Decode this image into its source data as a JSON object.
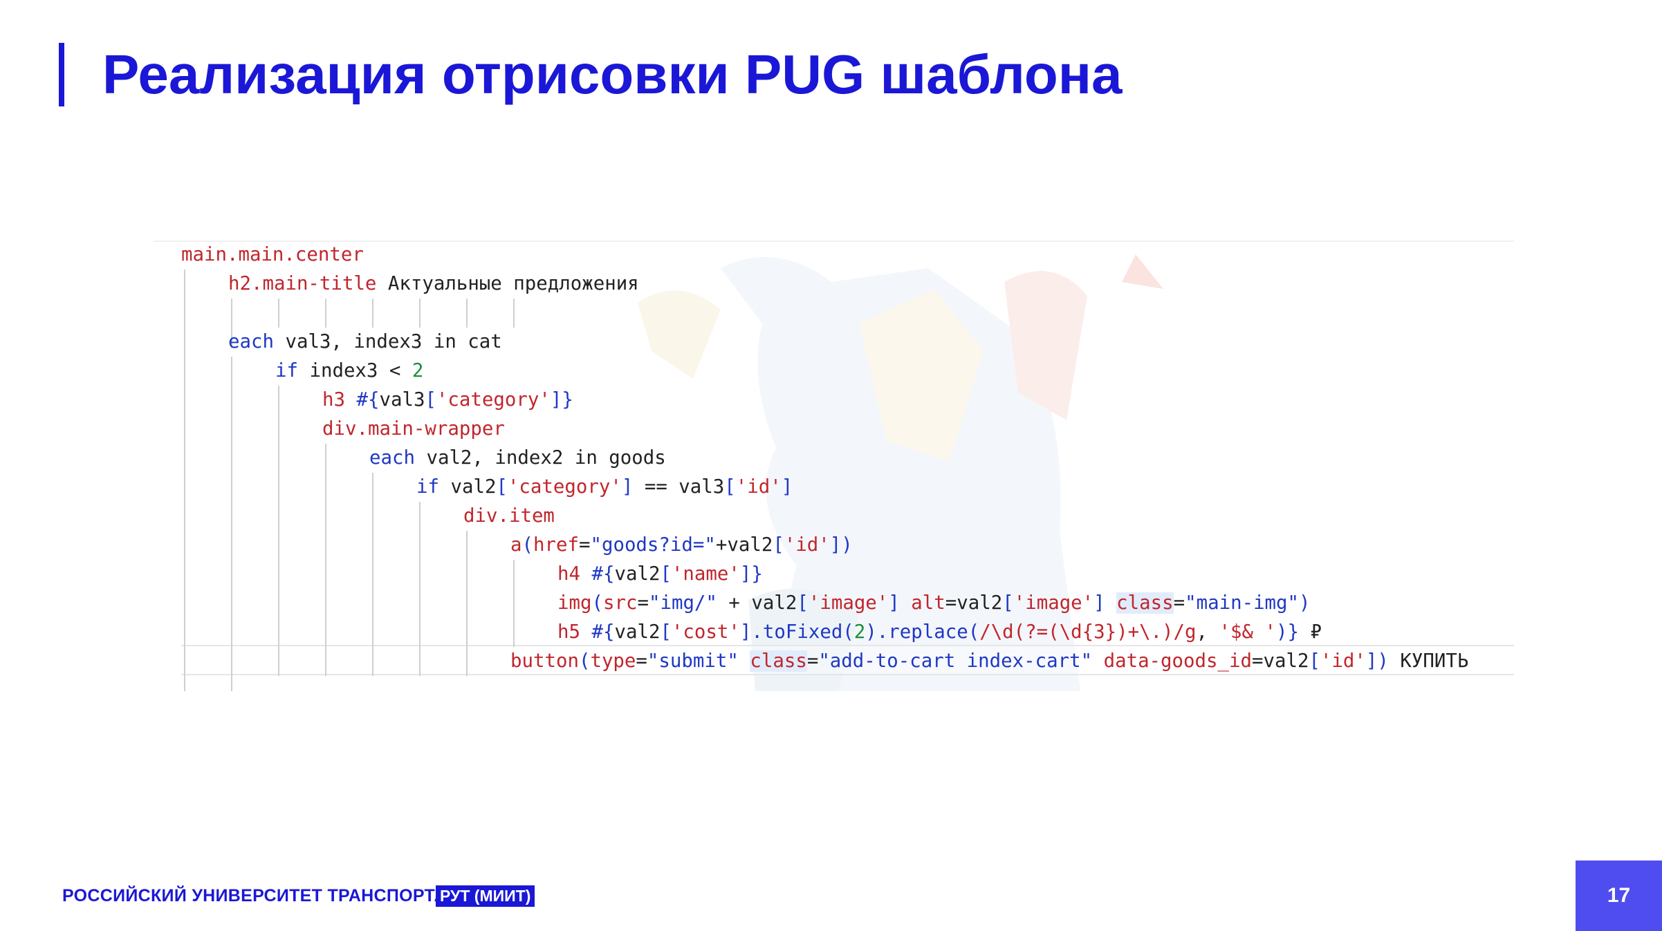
{
  "slide": {
    "title": "Реализация отрисовки PUG шаблона",
    "page_number": "17"
  },
  "footer": {
    "university": "РОССИЙСКИЙ УНИВЕРСИТЕТ ТРАНСПОРТА",
    "badge": "РУТ (МИИТ)"
  },
  "code": {
    "lines": [
      [
        {
          "t": "main.main.center",
          "c": "tag"
        }
      ],
      [
        {
          "t": "h2.main-title",
          "c": "tag"
        },
        {
          "t": " Актуальные предложения",
          "c": "txt"
        }
      ],
      [],
      [
        {
          "t": "each",
          "c": "kw"
        },
        {
          "t": " val3, index3 in cat",
          "c": "txt"
        }
      ],
      [
        {
          "t": "if",
          "c": "kw"
        },
        {
          "t": " index3 < ",
          "c": "txt"
        },
        {
          "t": "2",
          "c": "num"
        }
      ],
      [
        {
          "t": "h3 ",
          "c": "tag"
        },
        {
          "t": "#{",
          "c": "brk"
        },
        {
          "t": "val3",
          "c": "txt"
        },
        {
          "t": "[",
          "c": "brk"
        },
        {
          "t": "'category'",
          "c": "tag"
        },
        {
          "t": "]}",
          "c": "brk"
        }
      ],
      [
        {
          "t": "div.main-wrapper",
          "c": "tag"
        }
      ],
      [
        {
          "t": "each",
          "c": "kw"
        },
        {
          "t": " val2, index2 in goods",
          "c": "txt"
        }
      ],
      [
        {
          "t": "if",
          "c": "kw"
        },
        {
          "t": " val2",
          "c": "txt"
        },
        {
          "t": "[",
          "c": "brk"
        },
        {
          "t": "'category'",
          "c": "tag"
        },
        {
          "t": "]",
          "c": "brk"
        },
        {
          "t": " == val3",
          "c": "txt"
        },
        {
          "t": "[",
          "c": "brk"
        },
        {
          "t": "'id'",
          "c": "tag"
        },
        {
          "t": "]",
          "c": "brk"
        }
      ],
      [
        {
          "t": "div.item",
          "c": "tag"
        }
      ],
      [
        {
          "t": "a",
          "c": "tag"
        },
        {
          "t": "(",
          "c": "brk"
        },
        {
          "t": "href",
          "c": "attr"
        },
        {
          "t": "=",
          "c": "txt"
        },
        {
          "t": "\"goods?id=\"",
          "c": "str"
        },
        {
          "t": "+val2",
          "c": "txt"
        },
        {
          "t": "[",
          "c": "brk"
        },
        {
          "t": "'id'",
          "c": "tag"
        },
        {
          "t": "])",
          "c": "brk"
        }
      ],
      [
        {
          "t": "h4 ",
          "c": "tag"
        },
        {
          "t": "#{",
          "c": "brk"
        },
        {
          "t": "val2",
          "c": "txt"
        },
        {
          "t": "[",
          "c": "brk"
        },
        {
          "t": "'name'",
          "c": "tag"
        },
        {
          "t": "]}",
          "c": "brk"
        }
      ],
      [
        {
          "t": "img",
          "c": "tag"
        },
        {
          "t": "(",
          "c": "brk"
        },
        {
          "t": "src",
          "c": "attr"
        },
        {
          "t": "=",
          "c": "txt"
        },
        {
          "t": "\"img/\"",
          "c": "str"
        },
        {
          "t": " + val2",
          "c": "txt"
        },
        {
          "t": "[",
          "c": "brk"
        },
        {
          "t": "'image'",
          "c": "tag"
        },
        {
          "t": "]",
          "c": "brk"
        },
        {
          "t": " ",
          "c": "txt"
        },
        {
          "t": "alt",
          "c": "attr"
        },
        {
          "t": "=val2",
          "c": "txt"
        },
        {
          "t": "[",
          "c": "brk"
        },
        {
          "t": "'image'",
          "c": "tag"
        },
        {
          "t": "]",
          "c": "brk"
        },
        {
          "t": " ",
          "c": "txt"
        },
        {
          "t": "class",
          "c": "attr",
          "hl": true
        },
        {
          "t": "=",
          "c": "txt"
        },
        {
          "t": "\"main-img\"",
          "c": "str"
        },
        {
          "t": ")",
          "c": "brk"
        }
      ],
      [
        {
          "t": "h5 ",
          "c": "tag"
        },
        {
          "t": "#{",
          "c": "brk"
        },
        {
          "t": "val2",
          "c": "txt"
        },
        {
          "t": "[",
          "c": "brk"
        },
        {
          "t": "'cost'",
          "c": "tag"
        },
        {
          "t": "].toFixed(",
          "c": "brk"
        },
        {
          "t": "2",
          "c": "num"
        },
        {
          "t": ").replace(",
          "c": "brk"
        },
        {
          "t": "/\\d(?=(\\d{3})+\\.)/g",
          "c": "tag"
        },
        {
          "t": ", ",
          "c": "txt"
        },
        {
          "t": "'$& '",
          "c": "tag"
        },
        {
          "t": ")}",
          "c": "brk"
        },
        {
          "t": " ₽",
          "c": "txt"
        }
      ],
      [
        {
          "t": "button",
          "c": "tag"
        },
        {
          "t": "(",
          "c": "brk"
        },
        {
          "t": "type",
          "c": "attr"
        },
        {
          "t": "=",
          "c": "txt"
        },
        {
          "t": "\"submit\"",
          "c": "str"
        },
        {
          "t": " ",
          "c": "txt"
        },
        {
          "t": "class",
          "c": "attr",
          "hl": true
        },
        {
          "t": "=",
          "c": "txt"
        },
        {
          "t": "\"add-to-cart index-cart\"",
          "c": "str"
        },
        {
          "t": " ",
          "c": "txt"
        },
        {
          "t": "data-goods_id",
          "c": "attr"
        },
        {
          "t": "=val2",
          "c": "txt"
        },
        {
          "t": "[",
          "c": "brk"
        },
        {
          "t": "'id'",
          "c": "tag"
        },
        {
          "t": "])",
          "c": "brk"
        },
        {
          "t": " КУПИТЬ",
          "c": "txt"
        }
      ]
    ],
    "indents": [
      0,
      1,
      1,
      1,
      2,
      3,
      3,
      4,
      5,
      6,
      7,
      8,
      8,
      8,
      7
    ]
  }
}
